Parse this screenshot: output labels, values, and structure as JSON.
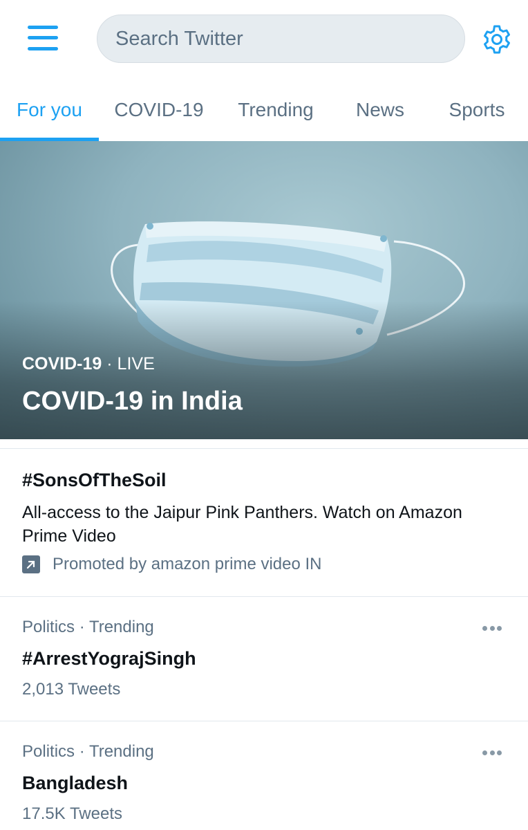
{
  "search": {
    "placeholder": "Search Twitter"
  },
  "icons": {
    "menu": "hamburger-menu-icon",
    "settings": "gear-icon",
    "promoted": "promoted-arrow-icon",
    "more": "more-dots-icon"
  },
  "colors": {
    "accent": "#1da1f2",
    "secondary_text": "#5b7083",
    "divider": "#e1e8ed",
    "search_bg": "#e6ecf0"
  },
  "tabs": [
    {
      "label": "For you",
      "active": true
    },
    {
      "label": "COVID-19",
      "active": false
    },
    {
      "label": "Trending",
      "active": false
    },
    {
      "label": "News",
      "active": false
    },
    {
      "label": "Sports",
      "active": false
    }
  ],
  "hero": {
    "category": "COVID-19",
    "separator": "·",
    "status": "LIVE",
    "title": "COVID-19 in India"
  },
  "promoted": {
    "title": "#SonsOfTheSoil",
    "description": "All-access to the Jaipur Pink Panthers. Watch on Amazon Prime Video",
    "promoted_by": "Promoted by amazon prime video IN"
  },
  "trends": [
    {
      "category": "Politics",
      "separator": "·",
      "label": "Trending",
      "title": "#ArrestYograjSingh",
      "count": "2,013 Tweets"
    },
    {
      "category": "Politics",
      "separator": "·",
      "label": "Trending",
      "title": "Bangladesh",
      "count": "17.5K Tweets"
    }
  ]
}
